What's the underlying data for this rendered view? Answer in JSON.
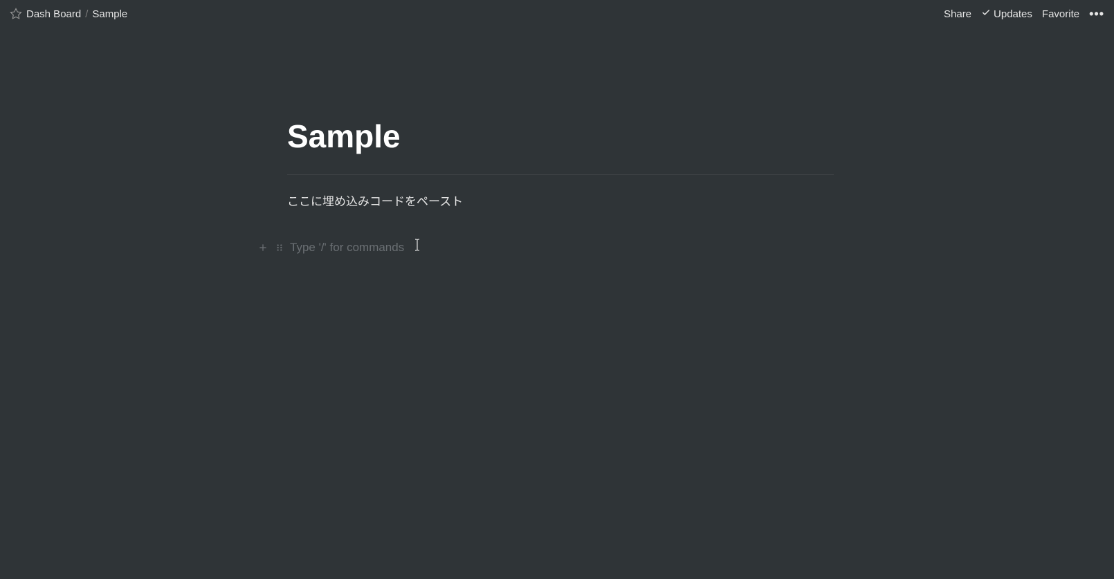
{
  "topbar": {
    "breadcrumb": [
      {
        "label": "Dash Board"
      },
      {
        "label": "Sample"
      }
    ],
    "separator": "/",
    "actions": {
      "share": "Share",
      "updates": "Updates",
      "favorite": "Favorite"
    }
  },
  "page": {
    "title": "Sample",
    "body_text": "ここに埋め込みコードをペースト",
    "block_placeholder": "Type '/' for commands"
  }
}
